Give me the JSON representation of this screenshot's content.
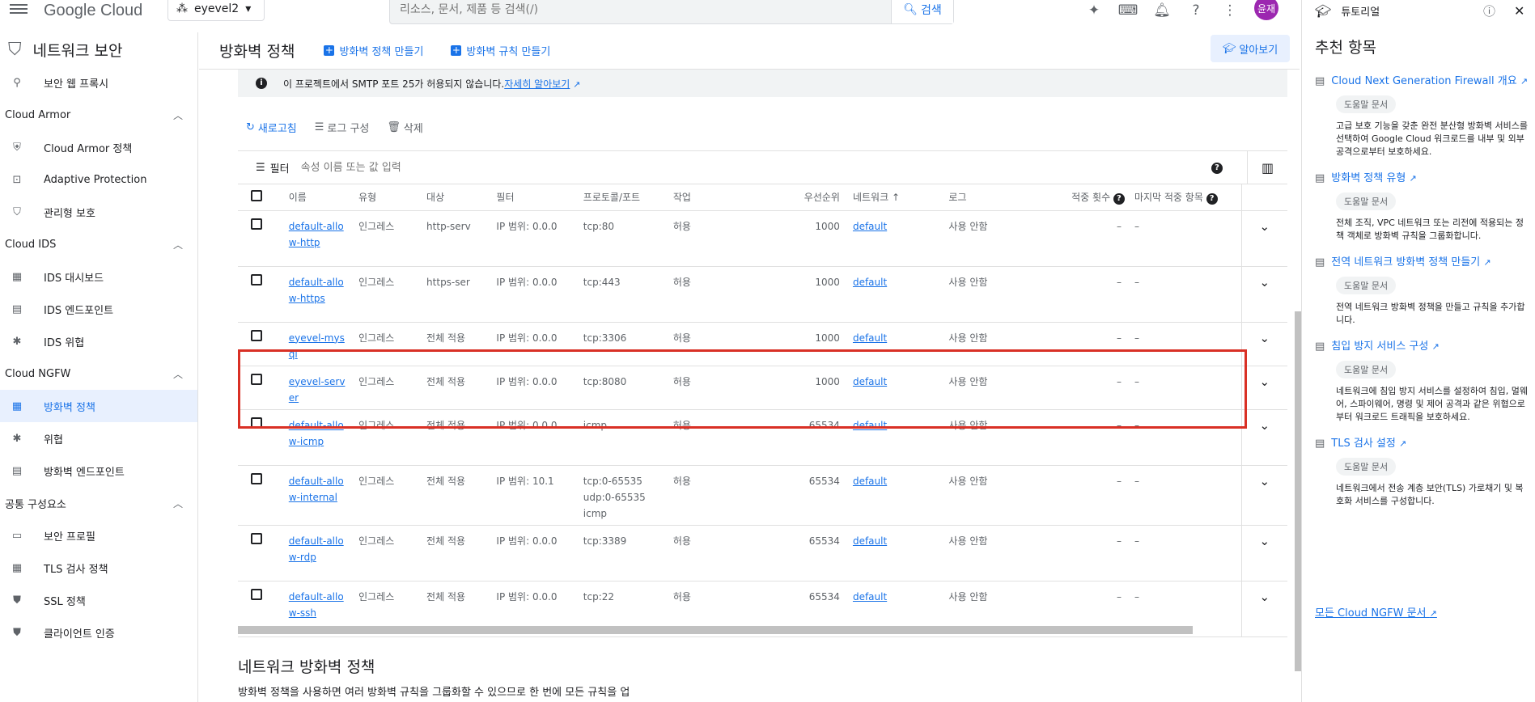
{
  "topbar": {
    "logo": "Google Cloud",
    "project": "eyevel2",
    "search_placeholder": "리소스, 문서, 제품 등 검색(/)",
    "search_button": "검색",
    "avatar_text": "윤재"
  },
  "leftnav": {
    "title": "네트워크 보안",
    "items": [
      {
        "label": "보안 웹 프록시"
      }
    ],
    "sections": [
      {
        "title": "Cloud Armor",
        "items": [
          "Cloud Armor 정책",
          "Adaptive Protection",
          "관리형 보호"
        ]
      },
      {
        "title": "Cloud IDS",
        "items": [
          "IDS 대시보드",
          "IDS 엔드포인트",
          "IDS 위협"
        ]
      },
      {
        "title": "Cloud NGFW",
        "items": [
          "방화벽 정책",
          "위협",
          "방화벽 엔드포인트"
        ]
      },
      {
        "title": "공통 구성요소",
        "items": [
          "보안 프로필",
          "TLS 검사 정책",
          "SSL 정책",
          "클라이언트 인증"
        ]
      }
    ]
  },
  "main": {
    "page_title": "방화벽 정책",
    "create_policy": "방화벽 정책 만들기",
    "create_rule": "방화벽 규칙 만들기",
    "learn": "알아보기",
    "info_text": "이 프로젝트에서 SMTP 포트 25가 허용되지 않습니다.",
    "info_link": "자세히 알아보기",
    "refresh": "새로고침",
    "log_config": "로그 구성",
    "delete": "삭제",
    "filter_label": "필터",
    "filter_placeholder": "속성 이름 또는 값 입력",
    "columns": [
      "이름",
      "유형",
      "대상",
      "필터",
      "프로토콜/포트",
      "작업",
      "우선순위",
      "네트워크",
      "로그",
      "적중 횟수",
      "마지막 적중 항목"
    ],
    "rows": [
      {
        "name": "default-allow-http",
        "type": "인그레스",
        "target": "http-serv",
        "filter": "IP 범위: 0.0.0",
        "proto": "tcp:80",
        "action": "허용",
        "priority": "1000",
        "network": "default",
        "log": "사용 안함",
        "hits": "–",
        "last": "–"
      },
      {
        "name": "default-allow-https",
        "type": "인그레스",
        "target": "https-ser",
        "filter": "IP 범위: 0.0.0",
        "proto": "tcp:443",
        "action": "허용",
        "priority": "1000",
        "network": "default",
        "log": "사용 안함",
        "hits": "–",
        "last": "–"
      },
      {
        "name": "eyevel-mysql",
        "type": "인그레스",
        "target": "전체 적용",
        "filter": "IP 범위: 0.0.0",
        "proto": "tcp:3306",
        "action": "허용",
        "priority": "1000",
        "network": "default",
        "log": "사용 안함",
        "hits": "–",
        "last": "–"
      },
      {
        "name": "eyevel-server",
        "type": "인그레스",
        "target": "전체 적용",
        "filter": "IP 범위: 0.0.0",
        "proto": "tcp:8080",
        "action": "허용",
        "priority": "1000",
        "network": "default",
        "log": "사용 안함",
        "hits": "–",
        "last": "–"
      },
      {
        "name": "default-allow-icmp",
        "type": "인그레스",
        "target": "전체 적용",
        "filter": "IP 범위: 0.0.0",
        "proto": "icmp",
        "action": "허용",
        "priority": "65534",
        "network": "default",
        "log": "사용 안함",
        "hits": "–",
        "last": "–"
      },
      {
        "name": "default-allow-internal",
        "type": "인그레스",
        "target": "전체 적용",
        "filter": "IP 범위: 10.1",
        "proto": "tcp:0-65535\nudp:0-65535\nicmp",
        "action": "허용",
        "priority": "65534",
        "network": "default",
        "log": "사용 안함",
        "hits": "–",
        "last": "–"
      },
      {
        "name": "default-allow-rdp",
        "type": "인그레스",
        "target": "전체 적용",
        "filter": "IP 범위: 0.0.0",
        "proto": "tcp:3389",
        "action": "허용",
        "priority": "65534",
        "network": "default",
        "log": "사용 안함",
        "hits": "–",
        "last": "–"
      },
      {
        "name": "default-allow-ssh",
        "type": "인그레스",
        "target": "전체 적용",
        "filter": "IP 범위: 0.0.0",
        "proto": "tcp:22",
        "action": "허용",
        "priority": "65534",
        "network": "default",
        "log": "사용 안함",
        "hits": "–",
        "last": "–"
      }
    ],
    "section_title": "네트워크 방화벽 정책",
    "section_desc": "방화벽 정책을 사용하면 여러 방화벽 규칙을 그룹화할 수 있으므로 한 번에 모든 규칙을 업"
  },
  "rightpanel": {
    "label": "튜토리얼",
    "title": "추천 항목",
    "cards": [
      {
        "link": "Cloud Next Generation Firewall 개요",
        "chip": "도움말 문서",
        "desc": "고급 보호 기능을 갖춘 완전 분산형 방화벽 서비스를 선택하여 Google Cloud 워크로드를 내부 및 외부 공격으로부터 보호하세요."
      },
      {
        "link": "방화벽 정책 유형",
        "chip": "도움말 문서",
        "desc": "전체 조직, VPC 네트워크 또는 리전에 적용되는 정책 객체로 방화벽 규칙을 그룹화합니다."
      },
      {
        "link": "전역 네트워크 방화벽 정책 만들기",
        "chip": "도움말 문서",
        "desc": "전역 네트워크 방화벽 정책을 만들고 규칙을 추가합니다."
      },
      {
        "link": "침입 방지 서비스 구성",
        "chip": "도움말 문서",
        "desc": "네트워크에 침입 방지 서비스를 설정하여 침입, 멀웨어, 스파이웨어, 명령 및 제어 공격과 같은 위협으로부터 워크로드 트래픽을 보호하세요."
      },
      {
        "link": "TLS 검사 설정",
        "chip": "도움말 문서",
        "desc": "네트워크에서 전송 계층 보안(TLS) 가로채기 및 복호화 서비스를 구성합니다."
      }
    ],
    "all_docs": "모든 Cloud NGFW 문서"
  }
}
